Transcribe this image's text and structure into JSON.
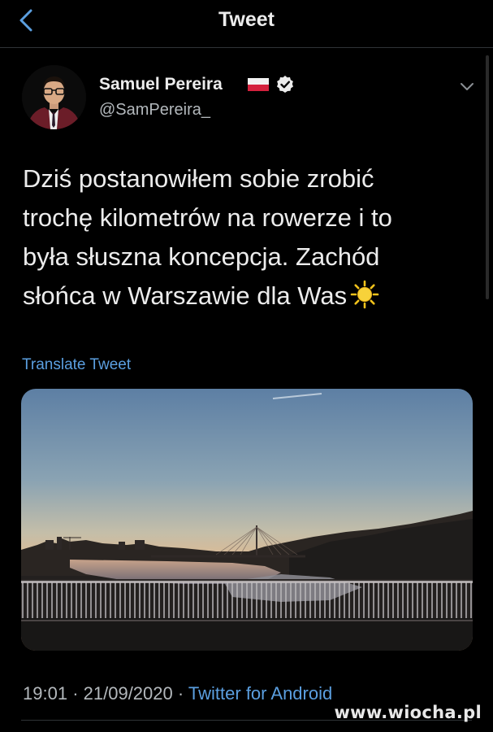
{
  "header": {
    "title": "Tweet",
    "back_icon": "chevron-left-icon"
  },
  "author": {
    "name": "Samuel Pereira",
    "handle": "@SamPereira_",
    "flag": "poland-flag",
    "verified_icon": "verified-badge-icon"
  },
  "tweet": {
    "lines": [
      "Dziś postanowiłem sobie zrobić",
      "trochę kilometrów na rowerze i to",
      "była słuszna koncepcja. Zachód",
      "słońca w Warszawie dla Was"
    ],
    "emoji": "sun-emoji"
  },
  "translate_label": "Translate Tweet",
  "meta": {
    "time": "19:01",
    "separator": "·",
    "date": "21/09/2020",
    "source": "Twitter for Android"
  },
  "watermark": "www.wiocha.pl",
  "colors": {
    "background": "#000000",
    "link": "#5b9fe0",
    "text": "#ececec",
    "muted": "#b3b8bc"
  }
}
